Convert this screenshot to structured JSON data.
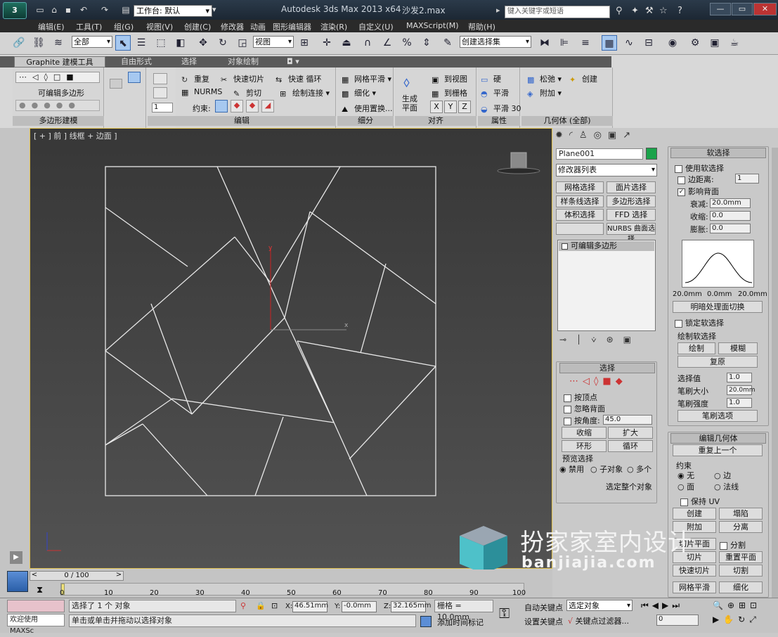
{
  "titlebar": {
    "workspace_label": "工作台: 默认",
    "app": "Autodesk 3ds Max  2013 x64",
    "file": "沙发2.max",
    "search_placeholder": "键入关键字或短语"
  },
  "menu": [
    "编辑(E)",
    "工具(T)",
    "组(G)",
    "视图(V)",
    "创建(C)",
    "修改器",
    "动画",
    "图形编辑器",
    "渲染(R)",
    "自定义(U)",
    "MAXScript(M)",
    "帮助(H)"
  ],
  "toolbar": {
    "filter": "全部",
    "refcoord": "视图",
    "named_sel": "创建选择集"
  },
  "ribbon": {
    "tabs": [
      "Graphite 建模工具",
      "自由形式",
      "选择",
      "对象绘制"
    ],
    "poly": {
      "label": "可编辑多边形",
      "footer": "多边形建模"
    },
    "edit": {
      "repeat": "重复",
      "quickslice": "快速切片",
      "quickloop": "快速 循环",
      "nurms": "NURMS",
      "cut": "剪切",
      "paintconnect": "绘制连接",
      "constraint": "约束:",
      "footer": "编辑"
    },
    "subdiv": {
      "meshsmooth": "网格平滑",
      "tessellate": "细化",
      "usedisplace": "使用置换...",
      "footer": "细分"
    },
    "align": {
      "makeplanar": "生成平面",
      "toview": "到视图",
      "togrid": "到栅格",
      "x": "X",
      "y": "Y",
      "z": "Z",
      "footer": "对齐"
    },
    "props": {
      "hard": "硬",
      "smooth": "平滑",
      "smooth30": "平滑 30",
      "footer": "属性"
    },
    "geom": {
      "relax": "松弛",
      "create": "创建",
      "attach": "附加",
      "footer": "几何体 (全部)"
    }
  },
  "viewport": {
    "label": "[ + ] 前 ] 线框 + 边面 ]",
    "axis_y": "y",
    "axis_x": "x"
  },
  "cmd": {
    "objname": "Plane001",
    "objcolor": "#1aa34a",
    "modlist": "修改器列表",
    "mods": [
      "网格选择",
      "面片选择",
      "样条线选择",
      "多边形选择",
      "体积选择",
      "FFD 选择",
      "",
      "NURBS 曲面选择"
    ],
    "stack_item": "可编辑多边形",
    "select": {
      "title": "选择",
      "byvertex": "按顶点",
      "ignoreback": "忽略背面",
      "byangle": "按角度:",
      "angle": "45.0",
      "shrink": "收缩",
      "grow": "扩大",
      "ring": "环形",
      "loop": "循环",
      "preview": "预览选择",
      "off": "禁用",
      "subobj": "子对象",
      "multi": "多个",
      "whole": "选定整个对象"
    }
  },
  "soft": {
    "title": "软选择",
    "use": "使用软选择",
    "edgedist": "边距离:",
    "edgeval": "1",
    "affectback": "影响背面",
    "falloff": "衰减:",
    "falloffv": "20.0mm",
    "pinch": "收缩:",
    "pinchv": "0.0",
    "bubble": "膨胀:",
    "bubblev": "0.0",
    "axis_l": "20.0mm",
    "axis_m": "0.0mm",
    "axis_r": "20.0mm",
    "shaded": "明暗处理面切换",
    "lock": "锁定软选择",
    "paint": "绘制软选择",
    "paintbtn": "绘制",
    "blur": "模糊",
    "revert": "复原",
    "selval": "选择值",
    "selv": "1.0",
    "brushsize": "笔刷大小",
    "brushv": "20.0mm",
    "brushstr": "笔刷强度",
    "strv": "1.0",
    "brushopt": "笔刷选项"
  },
  "editgeom": {
    "title": "编辑几何体",
    "repeat": "重复上一个",
    "constraint": "约束",
    "none": "无",
    "edge": "边",
    "face": "面",
    "normal": "法线",
    "keepuv": "保持 UV",
    "create": "创建",
    "collapse": "塌陷",
    "attach": "附加",
    "detach": "分离",
    "sliceplane": "切片平面",
    "split": "分割",
    "slice": "切片",
    "resetplane": "重置平面",
    "quickslice": "快速切片",
    "cut": "切割",
    "meshsmooth": "网格平滑",
    "tessellate": "细化"
  },
  "timeline": {
    "frame": "0 / 100",
    "ticks": [
      "0",
      "10",
      "20",
      "30",
      "40",
      "50",
      "60",
      "70",
      "80",
      "90",
      "100"
    ]
  },
  "status": {
    "welcome": "欢迎使用 MAXSc",
    "msg1": "选择了 1 个 对象",
    "msg2": "单击或单击并拖动以选择对象",
    "x": "46.51mm",
    "y": "-0.0mm",
    "z": "32.165mm",
    "grid": "栅格 = 10.0mm",
    "autokey": "自动关键点",
    "setkey": "设置关键点",
    "selected": "选定对象",
    "keyfilter": "关键点过滤器...",
    "addtime": "添加时间标记",
    "frame": "0"
  },
  "watermark": {
    "name": "扮家家室内设计",
    "url": "banjiajia.com"
  }
}
